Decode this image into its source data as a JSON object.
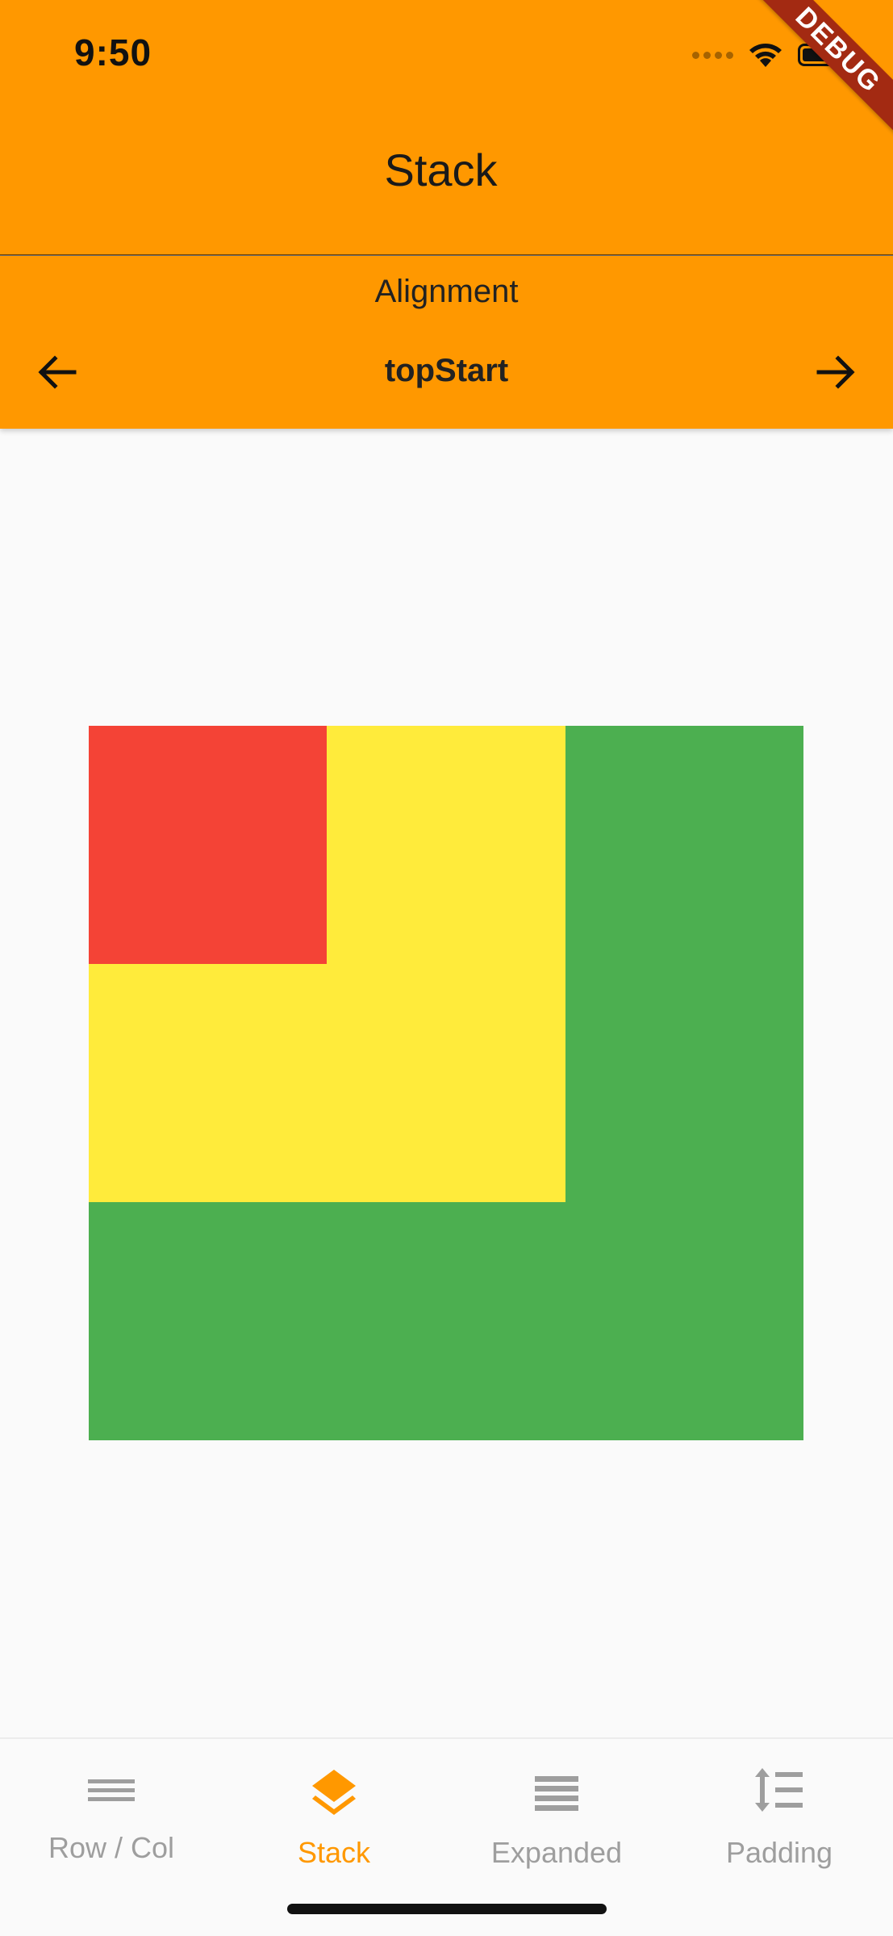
{
  "status_bar": {
    "time": "9:50"
  },
  "app_bar": {
    "title": "Stack",
    "debug_banner": "DEBUG",
    "background_color": "#ff9800"
  },
  "alignment_control": {
    "label": "Alignment",
    "value": "topStart",
    "prev_icon": "arrow-back-icon",
    "next_icon": "arrow-forward-icon"
  },
  "stack_demo": {
    "boxes": [
      {
        "name": "green",
        "color": "#4caf50"
      },
      {
        "name": "yellow",
        "color": "#ffeb3b"
      },
      {
        "name": "red",
        "color": "#f44336"
      }
    ]
  },
  "bottom_nav": {
    "active_color": "#ff9800",
    "inactive_color": "#9e9e9e",
    "items": [
      {
        "label": "Row / Col",
        "icon": "menu-lines-icon",
        "active": false
      },
      {
        "label": "Stack",
        "icon": "layers-icon",
        "active": true
      },
      {
        "label": "Expanded",
        "icon": "view-headline-icon",
        "active": false
      },
      {
        "label": "Padding",
        "icon": "format-line-spacing-icon",
        "active": false
      }
    ]
  }
}
